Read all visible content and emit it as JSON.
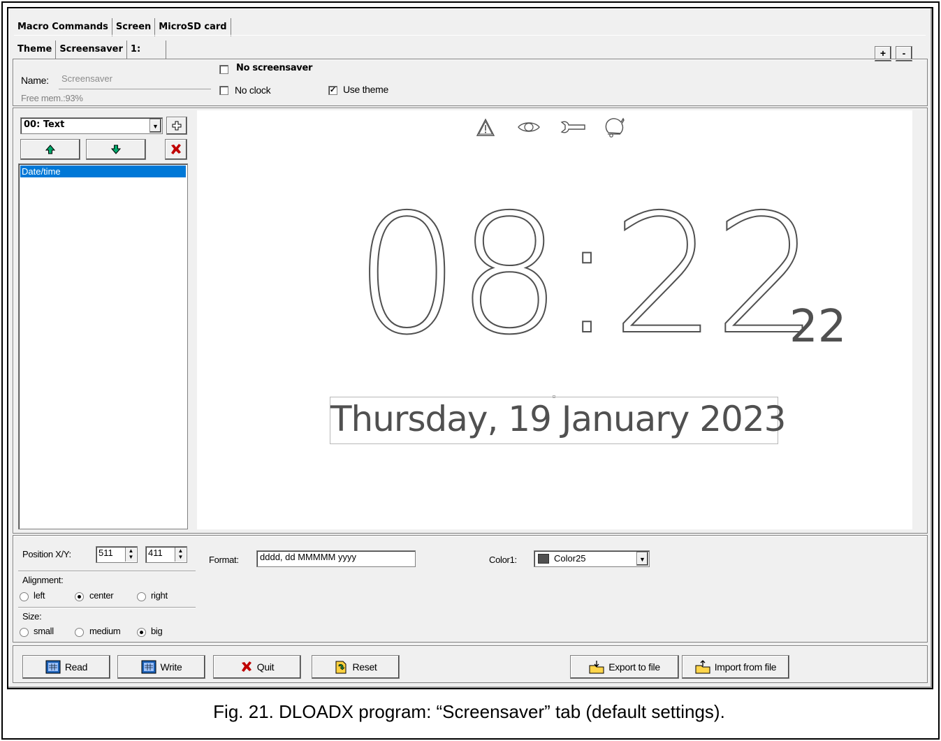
{
  "tabs_top": [
    "Macro Commands",
    "Screen",
    "MicroSD card"
  ],
  "tabs_sub": [
    "Theme",
    "Screensaver",
    "1:"
  ],
  "zoom_buttons": {
    "plus": "+",
    "minus": "-"
  },
  "name_label": "Name:",
  "name_value": "Screensaver",
  "free_mem": "Free mem.:93%",
  "no_screensaver": "No screensaver",
  "no_clock": "No clock",
  "use_theme": "Use theme",
  "element_select": "00: Text",
  "list_items": [
    "Date/time"
  ],
  "preview": {
    "icons": [
      "alarm-icon",
      "eye-icon",
      "wrench-icon",
      "bell-icon"
    ],
    "time": "08:22",
    "seconds": "22",
    "date": "Thursday, 19 January 2023"
  },
  "position_label": "Position X/Y:",
  "position_x": "511",
  "position_y": "411",
  "format_label": "Format:",
  "format_value": "dddd, dd MMMMM yyyy",
  "color_label": "Color1:",
  "color_value": "Color25",
  "color_swatch": "#505050",
  "alignment_label": "Alignment:",
  "alignment_options": [
    "left",
    "center",
    "right"
  ],
  "alignment_selected": "center",
  "size_label": "Size:",
  "size_options": [
    "small",
    "medium",
    "big"
  ],
  "size_selected": "big",
  "buttons": {
    "read": "Read",
    "write": "Write",
    "quit": "Quit",
    "reset": "Reset",
    "export": "Export to file",
    "import": "Import from file"
  },
  "caption": "Fig. 21. DLOADX program: “Screensaver” tab (default settings)."
}
